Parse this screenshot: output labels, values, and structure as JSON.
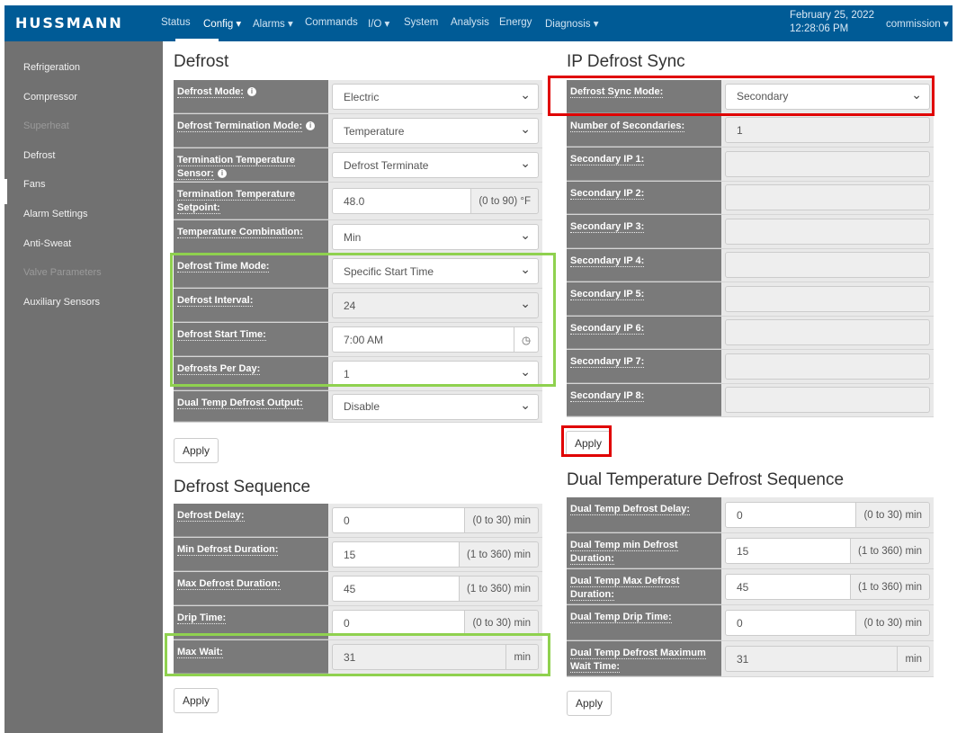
{
  "nav": {
    "logo": "HUSSMANN",
    "items": [
      "Status",
      "Config ▾",
      "Alarms ▾",
      "Commands",
      "I/O ▾",
      "System",
      "Analysis",
      "Energy",
      "Diagnosis ▾"
    ],
    "date": "February 25, 2022",
    "time": "12:28:06 PM",
    "user": "commission ▾"
  },
  "sidebar": [
    {
      "label": "Refrigeration",
      "enabled": true
    },
    {
      "label": "Compressor",
      "enabled": true
    },
    {
      "label": "Superheat",
      "enabled": false
    },
    {
      "label": "Defrost",
      "enabled": true,
      "active": true
    },
    {
      "label": "Fans",
      "enabled": true
    },
    {
      "label": "Alarm Settings",
      "enabled": true
    },
    {
      "label": "Anti-Sweat",
      "enabled": true
    },
    {
      "label": "Valve Parameters",
      "enabled": false
    },
    {
      "label": "Auxiliary Sensors",
      "enabled": true
    }
  ],
  "defrost": {
    "title": "Defrost",
    "apply": "Apply",
    "rows": [
      {
        "label": "Defrost Mode:",
        "info": true,
        "type": "select",
        "value": "Electric"
      },
      {
        "label": "Defrost Termination Mode:",
        "info": true,
        "type": "select",
        "value": "Temperature"
      },
      {
        "label": "Termination Temperature Sensor:",
        "info": true,
        "type": "select",
        "value": "Defrost Terminate"
      },
      {
        "label": "Termination Temperature Setpoint:",
        "type": "input",
        "value": "48.0",
        "addon": "(0 to 90) °F"
      },
      {
        "label": "Temperature Combination:",
        "type": "select",
        "value": "Min"
      },
      {
        "label": "Defrost Time Mode:",
        "type": "select",
        "value": "Specific Start Time"
      },
      {
        "label": "Defrost Interval:",
        "type": "select",
        "value": "24",
        "disabled": true
      },
      {
        "label": "Defrost Start Time:",
        "type": "time",
        "value": "7:00 AM"
      },
      {
        "label": "Defrosts Per Day:",
        "type": "select",
        "value": "1"
      },
      {
        "label": "Dual Temp Defrost Output:",
        "type": "select",
        "value": "Disable"
      }
    ]
  },
  "sequence": {
    "title": "Defrost Sequence",
    "apply": "Apply",
    "rows": [
      {
        "label": "Defrost Delay:",
        "type": "input",
        "value": "0",
        "addon": "(0 to 30) min"
      },
      {
        "label": "Min Defrost Duration:",
        "type": "input",
        "value": "15",
        "addon": "(1 to 360) min"
      },
      {
        "label": "Max Defrost Duration:",
        "type": "input",
        "value": "45",
        "addon": "(1 to 360) min"
      },
      {
        "label": "Drip Time:",
        "type": "input",
        "value": "0",
        "addon": "(0 to 30) min"
      },
      {
        "label": "Max Wait:",
        "type": "input",
        "value": "31",
        "addon": "min",
        "disabled": true
      }
    ]
  },
  "ipsync": {
    "title": "IP Defrost Sync",
    "apply": "Apply",
    "rows": [
      {
        "label": "Defrost Sync Mode:",
        "type": "select",
        "value": "Secondary"
      },
      {
        "label": "Number of Secondaries:",
        "type": "input",
        "value": "1",
        "disabled": true
      },
      {
        "label": "Secondary IP 1:",
        "type": "input",
        "value": "",
        "disabled": true
      },
      {
        "label": "Secondary IP 2:",
        "type": "input",
        "value": "",
        "disabled": true
      },
      {
        "label": "Secondary IP 3:",
        "type": "input",
        "value": "",
        "disabled": true
      },
      {
        "label": "Secondary IP 4:",
        "type": "input",
        "value": "",
        "disabled": true
      },
      {
        "label": "Secondary IP 5:",
        "type": "input",
        "value": "",
        "disabled": true
      },
      {
        "label": "Secondary IP 6:",
        "type": "input",
        "value": "",
        "disabled": true
      },
      {
        "label": "Secondary IP 7:",
        "type": "input",
        "value": "",
        "disabled": true
      },
      {
        "label": "Secondary IP 8:",
        "type": "input",
        "value": "",
        "disabled": true
      }
    ]
  },
  "dual": {
    "title": "Dual Temperature Defrost Sequence",
    "apply": "Apply",
    "rows": [
      {
        "label": "Dual Temp Defrost Delay:",
        "type": "input",
        "value": "0",
        "addon": "(0 to 30) min"
      },
      {
        "label": "Dual Temp min Defrost Duration:",
        "type": "input",
        "value": "15",
        "addon": "(1 to 360) min"
      },
      {
        "label": "Dual Temp Max Defrost Duration:",
        "type": "input",
        "value": "45",
        "addon": "(1 to 360) min"
      },
      {
        "label": "Dual Temp Drip Time:",
        "type": "input",
        "value": "0",
        "addon": "(0 to 30) min"
      },
      {
        "label": "Dual Temp Defrost Maximum Wait Time:",
        "type": "input",
        "value": "31",
        "addon": "min",
        "disabled": true
      }
    ]
  },
  "colors": {
    "nav": "#005b96",
    "sidebar": "#717171",
    "highlight_green": "#8fd14f",
    "highlight_red": "#e00000"
  }
}
